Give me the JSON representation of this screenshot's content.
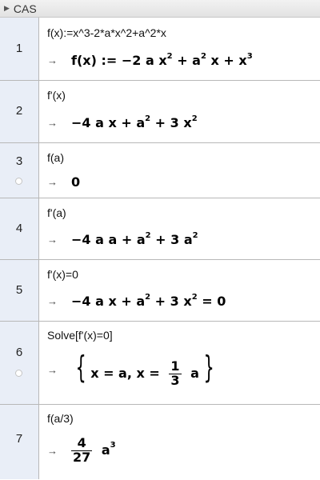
{
  "panel": {
    "title": "CAS"
  },
  "rows": [
    {
      "number": "1",
      "input": "f(x):=x^3-2*a*x^2+a^2*x",
      "output": "f(x) := −2 a x² + a² x + x³"
    },
    {
      "number": "2",
      "input": "f'(x)",
      "output": "−4 a x + a² + 3 x²"
    },
    {
      "number": "3",
      "input": "f(a)",
      "output": "0"
    },
    {
      "number": "4",
      "input": "f'(a)",
      "output": "−4 a a + a² + 3 a²"
    },
    {
      "number": "5",
      "input": "f'(x)=0",
      "output": "−4 a x + a² + 3 x² = 0"
    },
    {
      "number": "6",
      "input": "Solve[f'(x)=0]",
      "output": "{x = a, x = 1/3 a}"
    },
    {
      "number": "7",
      "input": "f(a/3)",
      "output": "4/27 a³"
    }
  ],
  "output_arrow": "→"
}
